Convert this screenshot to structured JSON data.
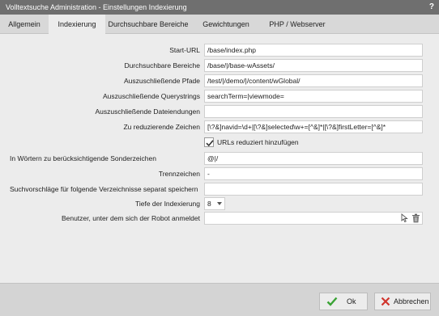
{
  "window": {
    "title": "Volltextsuche Administration - Einstellungen Indexierung",
    "help": "?"
  },
  "tabs": [
    {
      "label": "Allgemein"
    },
    {
      "label": "Indexierung"
    },
    {
      "label": "Durchsuchbare Bereiche"
    },
    {
      "label": "Gewichtungen"
    },
    {
      "label": "PHP / Webserver"
    }
  ],
  "form": {
    "start_url": {
      "label": "Start-URL",
      "value": "/base/index.php"
    },
    "searchable_areas": {
      "label": "Durchsuchbare Bereiche",
      "value": "/base/|/base-wAssets/"
    },
    "excluded_paths": {
      "label": "Auszuschließende Pfade",
      "value": "/test/|/demo/|/content/wGlobal/"
    },
    "excluded_querystrings": {
      "label": "Auszuschließende Querystrings",
      "value": "searchTerm=|viewmode="
    },
    "excluded_extensions": {
      "label": "Auszuschließende Dateiendungen",
      "value": ""
    },
    "reduce_chars": {
      "label": "Zu reduzierende Zeichen",
      "value": "[\\?&]navid=\\d+|[\\?&]selected\\w+=[^&]*|[\\?&]firstLetter=[^&]*"
    },
    "add_reduced": {
      "label": "URLs reduziert hinzufügen",
      "checked": true
    },
    "special_chars": {
      "label": "In Wörtern zu berücksichtigende Sonderzeichen",
      "value": "@|/"
    },
    "separators": {
      "label": "Trennzeichen",
      "value": "-"
    },
    "suggestions_dirs": {
      "label": "Suchvorschläge für folgende Verzeichnisse separat speichern",
      "value": ""
    },
    "depth": {
      "label": "Tiefe der Indexierung",
      "value": "8"
    },
    "robot_user": {
      "label": "Benutzer, unter dem sich der Robot anmeldet",
      "value": ""
    }
  },
  "footer": {
    "ok_label": "Ok",
    "cancel_label": "Abbrechen"
  },
  "icons": {
    "ok": "checkmark-icon",
    "cancel": "cross-icon",
    "select_user": "cursor-select-icon",
    "delete": "trash-icon"
  },
  "colors": {
    "titlebar": "#6f6f6f",
    "ok_green": "#3aa335",
    "cancel_red": "#d0342c"
  }
}
